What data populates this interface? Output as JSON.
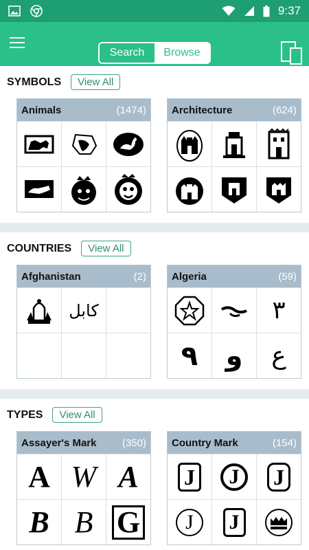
{
  "status": {
    "time": "9:37"
  },
  "header": {
    "tab_search": "Search",
    "tab_browse": "Browse"
  },
  "sections": [
    {
      "title": "SYMBOLS",
      "view_all": "View All",
      "cards": [
        {
          "name": "Animals",
          "count": "(1474)"
        },
        {
          "name": "Architecture",
          "count": "(624)"
        }
      ]
    },
    {
      "title": "COUNTRIES",
      "view_all": "View All",
      "cards": [
        {
          "name": "Afghanistan",
          "count": "(2)"
        },
        {
          "name": "Algeria",
          "count": "(59)"
        }
      ]
    },
    {
      "title": "TYPES",
      "view_all": "View All",
      "cards": [
        {
          "name": "Assayer's Mark",
          "count": "(350)"
        },
        {
          "name": "Country Mark",
          "count": "(154)"
        }
      ]
    }
  ],
  "marks": {
    "afghanistan_text": "كابل",
    "algeria": [
      "٣",
      "٩",
      "و",
      "ع"
    ],
    "assayer": [
      "A",
      "W",
      "A",
      "B",
      "B",
      "G"
    ],
    "country": [
      "J",
      "J",
      "J",
      "J",
      "J"
    ]
  },
  "colors": {
    "status_bar": "#1e9e73",
    "app_bar": "#2bbf8a",
    "card_header": "#a9bccb",
    "accent": "#3aa57c"
  },
  "icons": [
    "image-icon",
    "chrome-icon",
    "wifi-icon",
    "signal-icon",
    "battery-icon",
    "menu-icon",
    "devices-icon"
  ]
}
